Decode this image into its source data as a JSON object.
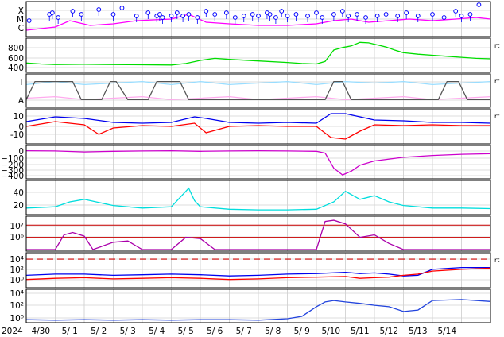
{
  "chart_data": {
    "type": "line",
    "date_axis": {
      "year_label": "2024",
      "tick_labels": [
        "4/30",
        "5/ 1",
        "5/ 2",
        "5/ 3",
        "5/ 4",
        "5/ 5",
        "5/ 6",
        "5/ 7",
        "5/ 8",
        "5/ 9",
        "5/10",
        "5/11",
        "5/12",
        "5/13",
        "5/14"
      ],
      "range": [
        "2024-04-29",
        "2024-05-15"
      ],
      "grid": true
    },
    "panels": [
      {
        "id": "xray",
        "tick_labels": [
          "X",
          "M",
          "C"
        ],
        "series": [
          {
            "color": "#ff00ff",
            "x": [
              0.0,
              1.0,
              1.5,
              2.2,
              3.0,
              3.8,
              5.0,
              5.6,
              6.2,
              7.0,
              8.0,
              9.0,
              10.0,
              10.6,
              11.2,
              11.8,
              12.5,
              13.2,
              14.0,
              14.8,
              15.5,
              16.0
            ],
            "class_level": [
              0.3,
              0.5,
              0.9,
              0.6,
              0.7,
              0.9,
              1.0,
              1.3,
              0.8,
              0.7,
              0.6,
              0.6,
              0.7,
              0.9,
              1.0,
              0.8,
              0.9,
              1.0,
              0.9,
              1.0,
              1.1,
              1.0
            ]
          }
        ],
        "flare_marker_color": "#0000ff",
        "flare_times": [
          0.1,
          0.8,
          0.9,
          1.1,
          1.6,
          1.9,
          2.5,
          3.0,
          3.3,
          3.8,
          4.2,
          4.5,
          4.6,
          4.7,
          5.0,
          5.2,
          5.4,
          5.6,
          5.9,
          6.2,
          6.5,
          6.9,
          7.2,
          7.5,
          7.8,
          8.0,
          8.3,
          8.4,
          8.6,
          8.8,
          9.0,
          9.3,
          9.7,
          10.0,
          10.2,
          10.6,
          10.9,
          11.1,
          11.4,
          11.7,
          12.1,
          12.4,
          12.8,
          13.1,
          13.5,
          14.0,
          14.4,
          14.8,
          15.0,
          15.3,
          15.6
        ],
        "flare_levels": [
          0.9,
          1.3,
          1.4,
          1.1,
          1.5,
          1.3,
          1.6,
          1.3,
          1.7,
          1.2,
          1.4,
          1.2,
          1.3,
          1.1,
          1.2,
          1.4,
          1.2,
          1.3,
          1.1,
          1.5,
          1.3,
          1.4,
          1.1,
          1.2,
          1.3,
          1.2,
          1.4,
          1.3,
          1.1,
          1.5,
          1.2,
          1.3,
          1.2,
          1.4,
          1.1,
          1.3,
          1.5,
          1.2,
          1.3,
          1.1,
          1.2,
          1.3,
          1.2,
          1.4,
          1.2,
          1.3,
          1.1,
          1.5,
          1.2,
          1.3,
          1.9
        ]
      },
      {
        "id": "speed",
        "tick_labels": [
          "400",
          "600",
          "800"
        ],
        "ylim": [
          300,
          900
        ],
        "series": [
          {
            "color": "#00dd00",
            "x": [
              0.0,
              0.5,
              1.0,
              2.0,
              3.0,
              4.0,
              5.0,
              5.5,
              6.0,
              6.5,
              7.0,
              8.0,
              9.0,
              9.5,
              10.0,
              10.3,
              10.6,
              10.9,
              11.2,
              11.5,
              11.8,
              12.1,
              12.4,
              12.7,
              13.0,
              13.5,
              14.0,
              14.5,
              15.0,
              15.5,
              16.0
            ],
            "y": [
              450,
              430,
              420,
              425,
              420,
              415,
              410,
              440,
              500,
              540,
              520,
              490,
              460,
              440,
              430,
              480,
              700,
              750,
              780,
              850,
              840,
              800,
              760,
              700,
              650,
              620,
              600,
              580,
              560,
              540,
              530
            ]
          }
        ],
        "unit_marker": "rt"
      },
      {
        "id": "imf-angle",
        "tick_labels": [
          "T",
          "A"
        ],
        "ylim": [
          0,
          1
        ],
        "series": [
          {
            "color": "#99ddff",
            "x": [
              0.0,
              1.0,
              2.0,
              3.0,
              4.0,
              5.0,
              6.0,
              7.0,
              8.0,
              9.0,
              10.0,
              11.0,
              12.0,
              13.0,
              14.0,
              15.0,
              16.0
            ],
            "y": [
              0.7,
              0.8,
              0.7,
              0.75,
              0.8,
              0.7,
              0.8,
              0.7,
              0.75,
              0.8,
              0.7,
              0.8,
              0.75,
              0.8,
              0.7,
              0.75,
              0.8
            ]
          },
          {
            "color": "#ffaaee",
            "x": [
              0.0,
              1.0,
              2.0,
              3.0,
              4.0,
              5.0,
              6.0,
              7.0,
              8.0,
              9.0,
              10.0,
              11.0,
              12.0,
              13.0,
              14.0,
              15.0,
              16.0
            ],
            "y": [
              0.25,
              0.3,
              0.2,
              0.25,
              0.3,
              0.2,
              0.25,
              0.3,
              0.2,
              0.25,
              0.3,
              0.2,
              0.25,
              0.3,
              0.2,
              0.25,
              0.3
            ]
          },
          {
            "color": "#555555",
            "x": [
              0.0,
              0.3,
              1.6,
              1.9,
              2.6,
              2.9,
              3.1,
              3.5,
              4.2,
              4.5,
              5.3,
              5.6,
              10.3,
              10.6,
              10.9,
              11.2,
              14.2,
              14.5,
              14.9,
              15.2,
              16.0
            ],
            "y": [
              0.2,
              0.8,
              0.8,
              0.2,
              0.2,
              0.8,
              0.8,
              0.2,
              0.2,
              0.8,
              0.8,
              0.2,
              0.2,
              0.8,
              0.8,
              0.2,
              0.2,
              0.8,
              0.8,
              0.2,
              0.2
            ]
          }
        ],
        "unit_marker": "rt"
      },
      {
        "id": "imf-b",
        "tick_labels": [
          "-10",
          "0",
          "10"
        ],
        "ylim": [
          -20,
          20
        ],
        "series": [
          {
            "color": "#0000ee",
            "x": [
              0.0,
              1.0,
              2.0,
              3.0,
              4.0,
              5.0,
              5.8,
              6.2,
              7.0,
              8.0,
              9.0,
              10.0,
              10.5,
              11.0,
              11.5,
              12.0,
              13.0,
              14.0,
              15.0,
              16.0
            ],
            "y": [
              6,
              12,
              10,
              5,
              4,
              5,
              12,
              10,
              5,
              4,
              5,
              4,
              16,
              16,
              12,
              8,
              7,
              5,
              5,
              4
            ]
          },
          {
            "color": "#ff0000",
            "x": [
              0.0,
              1.0,
              2.0,
              2.5,
              3.0,
              4.0,
              5.0,
              5.8,
              6.2,
              7.0,
              8.0,
              9.0,
              10.0,
              10.5,
              11.0,
              11.5,
              12.0,
              13.0,
              14.0,
              15.0,
              16.0
            ],
            "y": [
              0,
              6,
              2,
              -10,
              -2,
              1,
              0,
              4,
              -8,
              0,
              1,
              0,
              0,
              -14,
              -16,
              -6,
              2,
              1,
              2,
              1,
              1
            ]
          }
        ],
        "unit_marker": "rt"
      },
      {
        "id": "dst",
        "tick_labels": [
          "0",
          "−100",
          "−200",
          "−300",
          "−400"
        ],
        "ylim": [
          -450,
          50
        ],
        "series": [
          {
            "color": "#cc00cc",
            "x": [
              0.0,
              1.0,
              2.0,
              3.0,
              4.0,
              5.0,
              6.0,
              7.0,
              8.0,
              9.0,
              10.0,
              10.3,
              10.6,
              10.9,
              11.2,
              11.5,
              12.0,
              13.0,
              14.0,
              15.0,
              16.0
            ],
            "y": [
              -10,
              -15,
              -30,
              -20,
              -15,
              -10,
              -20,
              -15,
              -10,
              -15,
              -20,
              -50,
              -300,
              -412,
              -350,
              -250,
              -180,
              -120,
              -90,
              -70,
              -60
            ]
          }
        ]
      },
      {
        "id": "density",
        "tick_labels": [
          "20",
          "40"
        ],
        "ylim": [
          0,
          50
        ],
        "series": [
          {
            "color": "#00dddd",
            "x": [
              0.0,
              1.0,
              1.5,
              2.0,
              3.0,
              4.0,
              5.0,
              5.6,
              5.8,
              6.0,
              7.0,
              8.0,
              9.0,
              10.0,
              10.6,
              11.0,
              11.5,
              12.0,
              12.5,
              13.0,
              14.0,
              15.0,
              16.0
            ],
            "y": [
              8,
              10,
              18,
              22,
              12,
              8,
              10,
              40,
              20,
              10,
              6,
              5,
              5,
              6,
              18,
              35,
              22,
              28,
              18,
              12,
              8,
              8,
              7
            ]
          }
        ]
      },
      {
        "id": "proton-flux",
        "tick_labels": [
          "10⁶",
          "10⁷"
        ],
        "thresholds_log": [
          6,
          7
        ],
        "series": [
          {
            "color": "#aa00aa",
            "x": [
              0.0,
              1.0,
              1.3,
              1.6,
              2.0,
              2.3,
              3.0,
              3.5,
              4.0,
              5.0,
              5.5,
              6.0,
              6.5,
              7.0,
              8.0,
              9.0,
              10.0,
              10.3,
              10.6,
              11.0,
              11.5,
              12.0,
              12.5,
              13.0,
              14.0,
              15.0,
              16.0
            ],
            "y_log": [
              5,
              5,
              6.2,
              6.4,
              6.1,
              5,
              5.6,
              5.7,
              5,
              5,
              6,
              5.9,
              5,
              5,
              5,
              5,
              5,
              7.3,
              7.4,
              7.1,
              6.0,
              6.2,
              5.5,
              5,
              5,
              5,
              5
            ]
          }
        ]
      },
      {
        "id": "electron-flux",
        "tick_labels": [
          "10⁰",
          "10²",
          "10⁴"
        ],
        "threshold_log": 4,
        "series": [
          {
            "color": "#0000ee",
            "x": [
              0.0,
              1.0,
              2.0,
              3.0,
              4.0,
              5.0,
              6.0,
              7.0,
              8.0,
              9.0,
              10.0,
              11.0,
              11.5,
              12.0,
              12.5,
              13.0,
              13.5,
              14.0,
              15.0,
              16.0
            ],
            "y_log": [
              1.3,
              1.5,
              1.5,
              1.3,
              1.4,
              1.5,
              1.4,
              1.2,
              1.3,
              1.5,
              1.6,
              1.8,
              1.6,
              1.7,
              1.5,
              1.2,
              1.3,
              2.3,
              2.6,
              2.6
            ]
          },
          {
            "color": "#ff0000",
            "x": [
              0.0,
              1.0,
              2.0,
              3.0,
              4.0,
              5.0,
              6.0,
              7.0,
              8.0,
              9.0,
              10.0,
              11.0,
              11.5,
              12.0,
              12.5,
              13.0,
              13.5,
              14.0,
              15.0,
              16.0
            ],
            "y_log": [
              0.6,
              0.8,
              0.9,
              0.7,
              0.8,
              0.9,
              0.8,
              0.6,
              0.7,
              0.9,
              1.0,
              1.1,
              0.8,
              0.9,
              1.0,
              1.3,
              1.5,
              2.0,
              2.3,
              2.5
            ]
          }
        ],
        "unit_marker": "rt"
      },
      {
        "id": "xray-index",
        "tick_labels": [
          "10⁰",
          "10²",
          "10⁴"
        ],
        "series": [
          {
            "color": "#2244dd",
            "x": [
              0.0,
              1.0,
              2.0,
              3.0,
              4.0,
              5.0,
              6.0,
              7.0,
              8.0,
              9.0,
              9.5,
              10.0,
              10.3,
              10.6,
              11.0,
              11.5,
              12.0,
              12.5,
              13.0,
              13.5,
              14.0,
              15.0,
              16.0
            ],
            "y_log": [
              -1.2,
              -1.3,
              -1.2,
              -1.3,
              -1.2,
              -1.3,
              -1.2,
              -1.2,
              -1.3,
              -1.0,
              -0.5,
              1.5,
              2.5,
              2.8,
              2.5,
              2.2,
              1.8,
              1.5,
              0.5,
              0.8,
              2.8,
              3.0,
              2.6
            ]
          }
        ]
      }
    ]
  }
}
